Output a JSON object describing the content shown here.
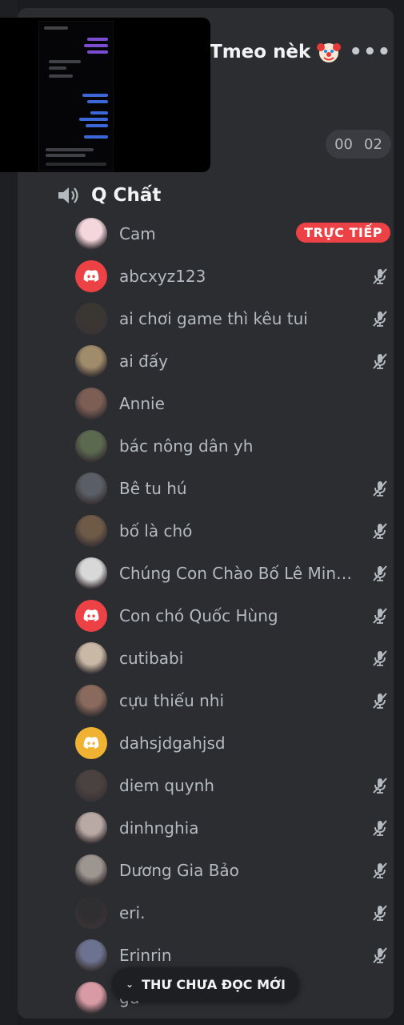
{
  "header": {
    "server_name": "Tmeo nèk",
    "more_label": "•••"
  },
  "timer": {
    "left": "00",
    "right": "02"
  },
  "channel": {
    "name": "Q Chất",
    "icon": "speaker-icon"
  },
  "members": [
    {
      "name": "Cam",
      "avatar": "photo",
      "avatar_color": "#f3d7dd",
      "muted": false,
      "live": true,
      "live_label": "TRỰC TIẾP"
    },
    {
      "name": "abcxyz123",
      "avatar": "discord-red",
      "muted": true
    },
    {
      "name": "ai chơi game thì kêu tui",
      "avatar": "photo",
      "avatar_color": "#3a3632",
      "muted": true
    },
    {
      "name": "ai đấy",
      "avatar": "photo",
      "avatar_color": "#a08b6a",
      "muted": true
    },
    {
      "name": "Annie",
      "avatar": "photo",
      "avatar_color": "#7d5e55",
      "muted": false
    },
    {
      "name": "bác nông dân yh",
      "avatar": "photo",
      "avatar_color": "#5b6a4f",
      "muted": false
    },
    {
      "name": "Bê tu hú",
      "avatar": "photo",
      "avatar_color": "#5a5e66",
      "muted": true
    },
    {
      "name": "bố là chó",
      "avatar": "photo",
      "avatar_color": "#6f5a48",
      "muted": true
    },
    {
      "name": "Chúng Con Chào Bố Lê Minh Phú",
      "avatar": "photo",
      "avatar_color": "#d8d8d8",
      "muted": true
    },
    {
      "name": "Con chó Quốc Hùng",
      "avatar": "discord-red",
      "muted": true
    },
    {
      "name": "cutibabi",
      "avatar": "photo",
      "avatar_color": "#c9b8a6",
      "muted": true
    },
    {
      "name": "cựu thiếu nhi",
      "avatar": "photo",
      "avatar_color": "#8a6a5c",
      "muted": true
    },
    {
      "name": "dahsjdgahjsd",
      "avatar": "discord-yellow",
      "muted": false
    },
    {
      "name": "diem quynh",
      "avatar": "photo",
      "avatar_color": "#4a4240",
      "muted": true
    },
    {
      "name": "dinhnghia",
      "avatar": "photo",
      "avatar_color": "#b9a9a4",
      "muted": true
    },
    {
      "name": "Dương Gia Bảo",
      "avatar": "photo",
      "avatar_color": "#9c9590",
      "muted": true
    },
    {
      "name": "eri.",
      "avatar": "photo",
      "avatar_color": "#2f2e30",
      "muted": true
    },
    {
      "name": "Erinrin",
      "avatar": "photo",
      "avatar_color": "#6c7390",
      "muted": true
    },
    {
      "name": "gu",
      "avatar": "photo",
      "avatar_color": "#d89aa5",
      "muted": false
    }
  ],
  "unread_banner": {
    "label": "THƯ CHƯA ĐỌC MỚI"
  },
  "colors": {
    "background": "#2b2d31",
    "live_badge": "#ec4145",
    "discord_red": "#ec4145",
    "discord_yellow": "#f0b232",
    "muted_text": "#b5bac1"
  }
}
